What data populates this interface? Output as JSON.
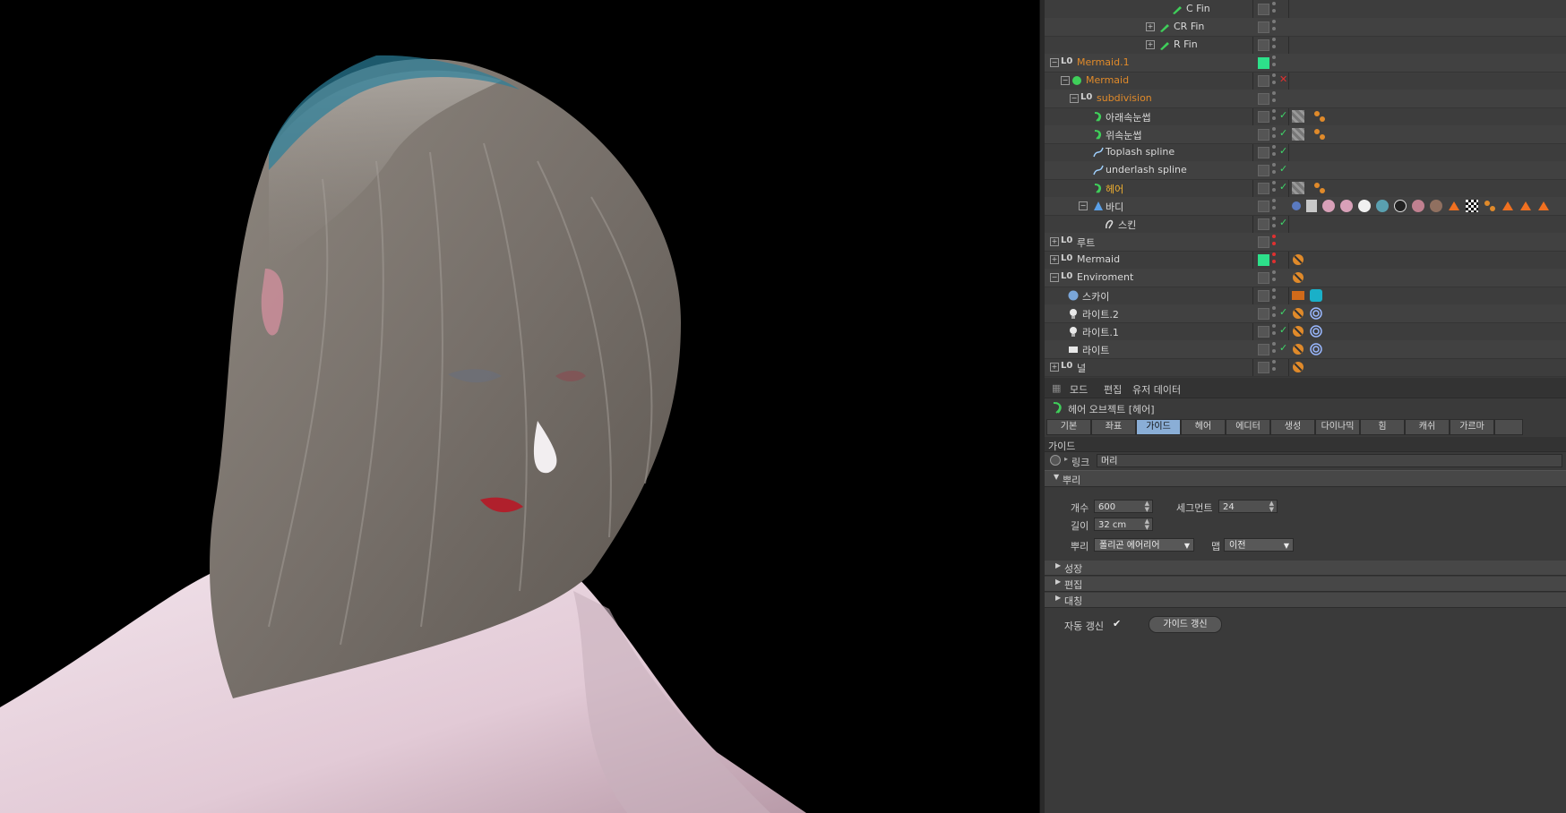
{
  "object_manager": {
    "rows": [
      {
        "name": "C Fin",
        "color": "white",
        "indent": 2
      },
      {
        "name": "CR Fin",
        "color": "white",
        "indent": 2
      },
      {
        "name": "R Fin",
        "color": "white",
        "indent": 2
      },
      {
        "name": "Mermaid.1",
        "color": "orange",
        "indent": 0
      },
      {
        "name": "Mermaid",
        "color": "orange",
        "indent": 1
      },
      {
        "name": "subdivision",
        "color": "orange",
        "indent": 2
      },
      {
        "name": "아래속눈썹",
        "color": "white",
        "indent": 3
      },
      {
        "name": "위속눈썹",
        "color": "white",
        "indent": 3
      },
      {
        "name": "Toplash spline",
        "color": "white",
        "indent": 3
      },
      {
        "name": "underlash spline",
        "color": "white",
        "indent": 3
      },
      {
        "name": "헤어",
        "color": "yellow",
        "indent": 3
      },
      {
        "name": "바디",
        "color": "white",
        "indent": 3
      },
      {
        "name": "스킨",
        "color": "white",
        "indent": 4
      },
      {
        "name": "루트",
        "color": "white",
        "indent": 0
      },
      {
        "name": "Mermaid",
        "color": "white",
        "indent": 0
      },
      {
        "name": "Enviroment",
        "color": "white",
        "indent": 0
      },
      {
        "name": "스카이",
        "color": "white",
        "indent": 1
      },
      {
        "name": "라이트.2",
        "color": "white",
        "indent": 1
      },
      {
        "name": "라이트.1",
        "color": "white",
        "indent": 1
      },
      {
        "name": "라이트",
        "color": "white",
        "indent": 1
      },
      {
        "name": "널",
        "color": "white",
        "indent": 0
      }
    ]
  },
  "attribute_manager": {
    "menu": [
      "모드",
      "편집",
      "유저 데이터"
    ],
    "object_title": "헤어 오브젝트 [헤어]",
    "tabs": [
      "기본",
      "좌표",
      "가이드",
      "헤어",
      "에디터",
      "생성",
      "다이나믹",
      "힘",
      "캐쉬",
      "가르마"
    ],
    "active_tab": "가이드",
    "section_title": "가이드",
    "link_label": "링크",
    "link_value": "머리",
    "root_section": "뿌리",
    "count_label": "개수",
    "count_value": "600",
    "segment_label": "세그먼트",
    "segment_value": "24",
    "length_label": "길이",
    "length_value": "32 cm",
    "root_label": "뿌리",
    "root_value": "폴리곤 에어리어",
    "map_label": "맵",
    "map_value": "이전",
    "collapsed_sections": [
      "성장",
      "편집",
      "대칭"
    ],
    "auto_update_label": "자동 갱신",
    "auto_update_checked": "✔",
    "update_button": "가이드 갱신"
  },
  "colors": {
    "orange_name": "#e08a2a",
    "yellow_name": "#f0b030",
    "active_tab": "#8aaed6",
    "layer_green": "#2de08a"
  }
}
